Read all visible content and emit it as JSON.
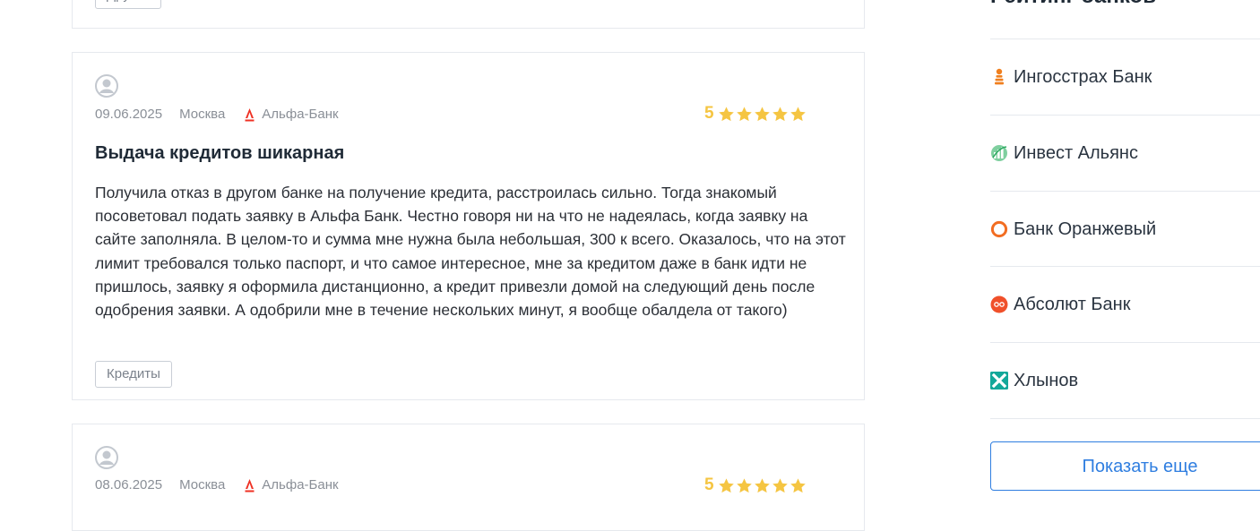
{
  "reviews": [
    {
      "tag": "Другое"
    },
    {
      "date": "09.06.2025",
      "city": "Москва",
      "bank": "Альфа-Банк",
      "rating": "5",
      "title": "Выдача кредитов шикарная",
      "text": "Получила отказ в другом банке на получение кредита, расстроилась сильно. Тогда знакомый посоветовал подать заявку в Альфа Банк. Честно говоря ни на что не надеялась, когда заявку на сайте заполняла. В целом-то и сумма мне нужна была небольшая, 300 к всего. Оказалось, что на этот лимит требовался только паспорт, и что самое интересное, мне за кредитом даже в банк идти не пришлось, заявку я оформила дистанционно, а кредит привезли домой на следующий день после одобрения заявки. А одобрили мне в течение нескольких минут, я вообще обалдела от такого)",
      "tag": "Кредиты"
    },
    {
      "date": "08.06.2025",
      "city": "Москва",
      "bank": "Альфа-Банк",
      "rating": "5"
    }
  ],
  "sidebar": {
    "heading": "Рейтинг банков",
    "banks": [
      {
        "name": "Ингосстрах Банк",
        "icon": "ingosstrakh-logo-icon"
      },
      {
        "name": "Инвест Альянс",
        "icon": "invest-alliance-logo-icon"
      },
      {
        "name": "Банк Оранжевый",
        "icon": "orange-bank-logo-icon"
      },
      {
        "name": "Абсолют Банк",
        "icon": "absolut-bank-logo-icon"
      },
      {
        "name": "Хлынов",
        "icon": "khlynov-logo-icon"
      }
    ],
    "show_more": "Показать еще"
  },
  "colors": {
    "star": "#f5c542",
    "alfa_red": "#ef3124",
    "link_blue": "#2f7ee0"
  }
}
